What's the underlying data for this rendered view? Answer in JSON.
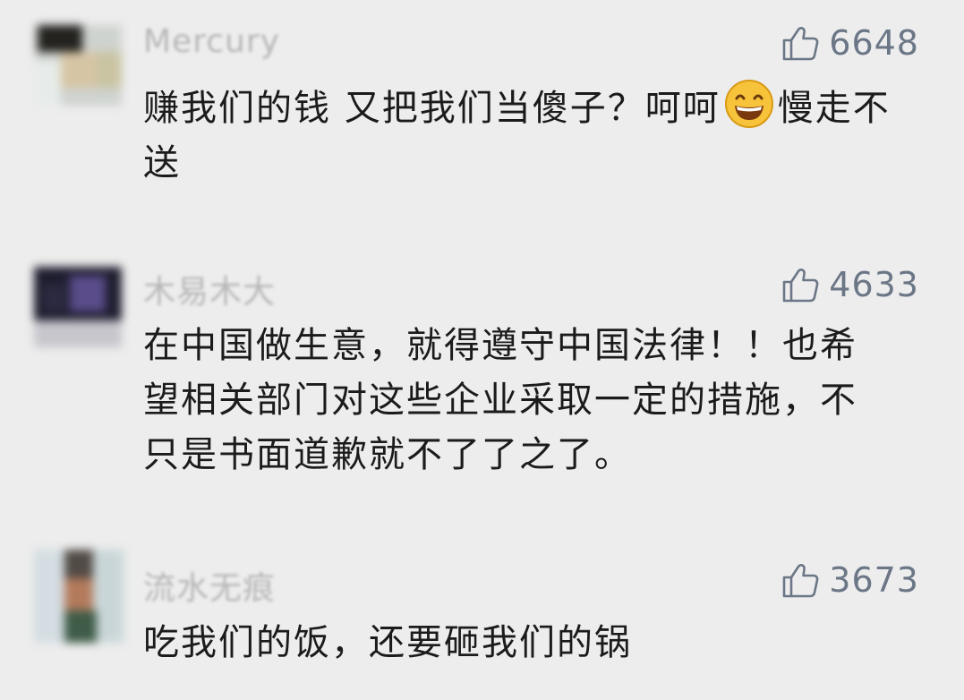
{
  "comments": [
    {
      "username": "Mercury",
      "likes": "6648",
      "text_before_emoji": "赚我们的钱 又把我们当傻子？呵呵",
      "emoji": "grinning-face",
      "text_after_emoji": "慢走不送"
    },
    {
      "username": "木易木大",
      "likes": "4633",
      "text": "在中国做生意，就得遵守中国法律！！也希望相关部门对这些企业采取一定的措施，不只是书面道歉就不了了之了。"
    },
    {
      "username": "流水无痕",
      "likes": "3673",
      "text": "吃我们的饭，还要砸我们的锅"
    }
  ],
  "icons": {
    "like": "thumbs-up-icon"
  },
  "colors": {
    "background": "#ededed",
    "like_count": "#6b7686",
    "username": "#b7b7b7",
    "text": "#1b1b1b"
  }
}
